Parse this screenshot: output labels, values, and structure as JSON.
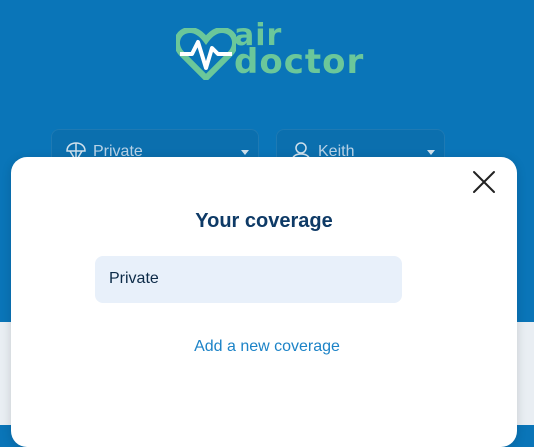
{
  "app": {
    "logo_text_top": "air",
    "logo_text_bottom": "doctor",
    "brand_color": "#6bc79a",
    "header_color": "#0a75b8"
  },
  "selectors": {
    "coverage": {
      "value": "Private",
      "icon": "umbrella-icon"
    },
    "user": {
      "value": "Keith",
      "icon": "user-icon"
    }
  },
  "modal": {
    "title": "Your coverage",
    "options": [
      {
        "label": "Private"
      }
    ],
    "add_link": "Add a new coverage",
    "close_icon": "close-icon"
  }
}
